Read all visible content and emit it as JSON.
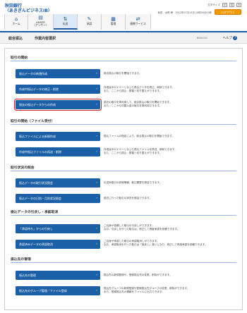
{
  "header": {
    "logo_line1": "秋田銀行",
    "logo_line2": "〈あきぎんビジネスIB〉",
    "font_size_label": "文字サイズ",
    "font_sizes": [
      "小",
      "中",
      "大"
    ],
    "user_line": "秋田　太郎 様　2012年07月13日 10時30分00秒",
    "logout": "ログアウト"
  },
  "nav": [
    {
      "label": "ホーム",
      "icon": "home-icon",
      "glyph": "⌂"
    },
    {
      "label": "ANSER\n（アンサー）",
      "icon": "anser-icon",
      "glyph": "▤"
    },
    {
      "label": "伝送",
      "icon": "transfer-icon",
      "glyph": "⇅"
    },
    {
      "label": "承認",
      "icon": "approval-icon",
      "glyph": "✎"
    },
    {
      "label": "管理",
      "icon": "admin-icon",
      "glyph": "▦"
    },
    {
      "label": "連携サービス",
      "icon": "link-service-icon",
      "glyph": "⇄"
    }
  ],
  "sub": {
    "category": "総合振込",
    "title": "作業内容選択",
    "screen_code": "BSSK001",
    "help": "ヘルプ",
    "help_glyph": "?"
  },
  "sections": [
    {
      "title": "取引の開始",
      "items": [
        {
          "label": "振込データの新規作成",
          "desc": "総合振込の取引を開始できます。"
        },
        {
          "label": "作成中振込データの修正・削除",
          "desc": "作成途中やエラーとなった振込データを修正、削除できます。\nまた、ここから振込・振替へ切り替えができます。"
        },
        {
          "label": "過去の振込データからの作成",
          "desc": "過去の取引を再利用して、総合振込の取引を開始できます。\nまた、ここから切替入金の取引を再利用できます。"
        }
      ]
    },
    {
      "title": "取引の開始（ファイル受付）",
      "items": [
        {
          "label": "振込ファイルによる新規作成",
          "desc": "振込ファイルの指定により、総合振込の取引を開始できます。"
        },
        {
          "label": "作成中振込ファイルの再送・削除",
          "desc": "作成途中やエラーとなった振込ファイルを再送、削除できます。\nまた、ここから振込・振替へ切り替えができます。"
        }
      ]
    },
    {
      "title": "取引状況の照会",
      "items": [
        {
          "label": "振込データの取引状況照会",
          "desc": "伝送系取引の詳細情報、取引履歴を照会できます。"
        },
        {
          "label": "振込データの日別・月別状況照会",
          "desc": "過去に行った取引の状況を照会できます。"
        }
      ]
    },
    {
      "title": "振込データの引戻し・承認取消",
      "items": [
        {
          "label": "「承認待ち」からの引戻し",
          "desc": "ご自身が依頼した取引の引戻しができます。\nなお、引戻しを行った取引は、修正して再度承認を依頼できます。"
        },
        {
          "label": "承認済みデータの承認取消",
          "desc": "ご自身が承認した取引の承認取消しができます。\nなお、承認取消を行った取引は「差戻し」扱いとなり、修正して再度承認を依頼できます。"
        }
      ]
    },
    {
      "title": "振込先の管理",
      "items": [
        {
          "label": "振込先の管理",
          "desc": "振込先の新規登録や、登録振込先の変更、削除ができます。"
        },
        {
          "label": "振込先のグループ管理／ファイル登録",
          "desc": "振込先グループの新規登録や登録振込先グループの変更、削除ができます。\nまた、登録振込先の情報をファイルに出力できます。"
        }
      ]
    }
  ],
  "colors": {
    "accent": "#1b5fa6",
    "highlight": "#d81e1e",
    "logout": "#f39800"
  }
}
